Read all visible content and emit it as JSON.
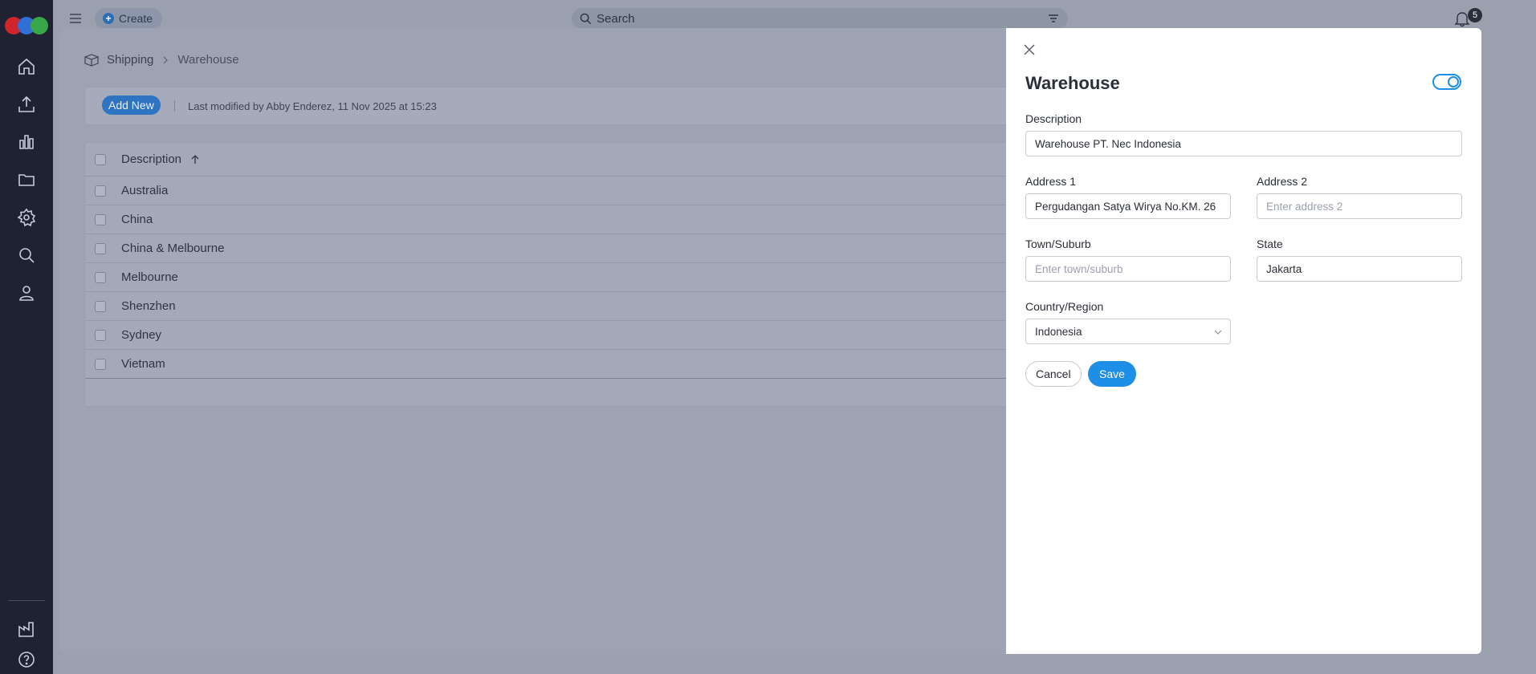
{
  "topbar": {
    "create_label": "Create",
    "search_placeholder": "Search",
    "notification_count": "5"
  },
  "breadcrumb": {
    "parent": "Shipping",
    "current": "Warehouse"
  },
  "toolbar": {
    "add_new_label": "Add New",
    "modified_text": "Last modified by Abby Enderez, 11 Nov 2025 at 15:23"
  },
  "table": {
    "header": "Description",
    "rows": [
      "Australia",
      "China",
      "China & Melbourne",
      "Melbourne",
      "Shenzhen",
      "Sydney",
      "Vietnam"
    ]
  },
  "modal": {
    "title": "Warehouse",
    "description_label": "Description",
    "description_value": "Warehouse PT. Nec Indonesia",
    "address1_label": "Address 1",
    "address1_value": "Pergudangan Satya Wirya No.KM. 26",
    "address2_label": "Address 2",
    "address2_placeholder": "Enter address 2",
    "town_label": "Town/Suburb",
    "town_placeholder": "Enter town/suburb",
    "state_label": "State",
    "state_value": "Jakarta",
    "country_label": "Country/Region",
    "country_value": "Indonesia",
    "cancel_label": "Cancel",
    "save_label": "Save"
  },
  "colors": {
    "accent": "#1d8fe6",
    "sidebar": "#1f2233"
  }
}
